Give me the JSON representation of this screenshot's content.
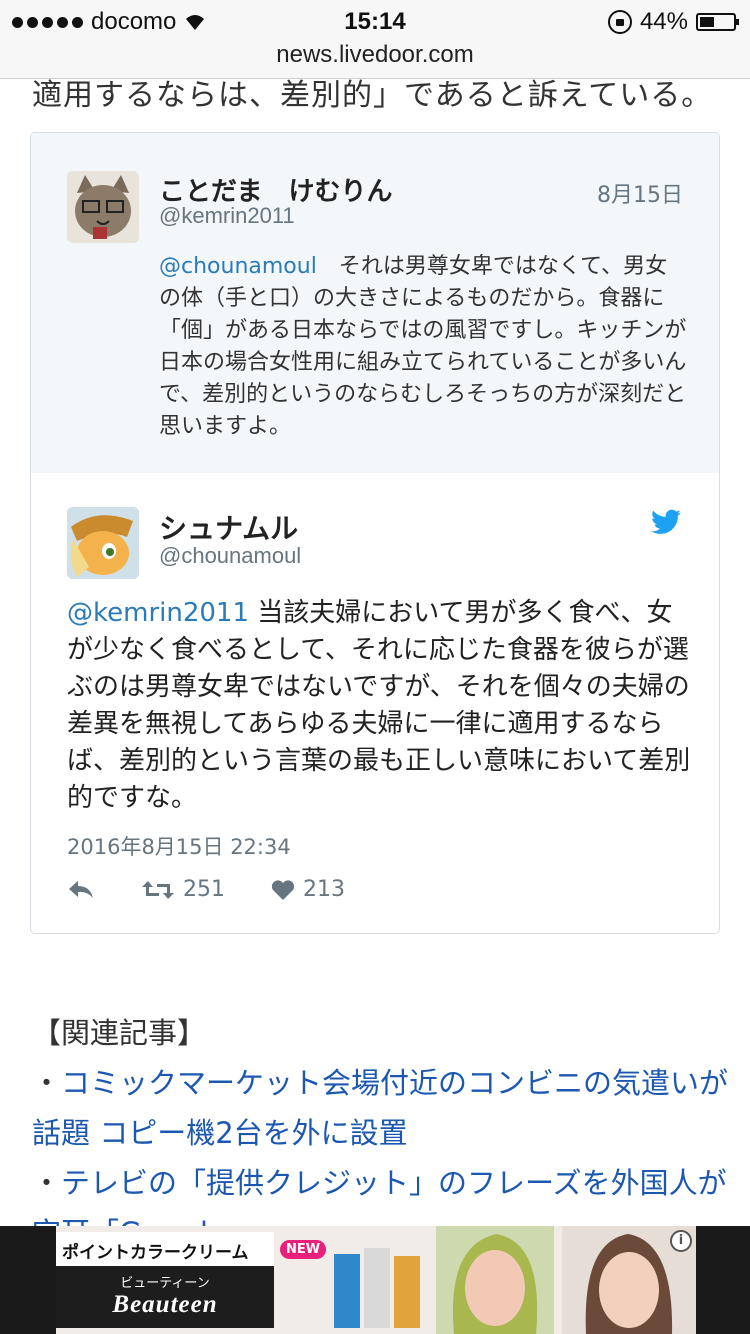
{
  "status_bar": {
    "carrier": "docomo",
    "time": "15:14",
    "battery_text": "44%",
    "battery_level": 0.44
  },
  "browser": {
    "url": "news.livedoor.com"
  },
  "article": {
    "cut_line": "適用するならは、差別的」であると訴えている。"
  },
  "tweet": {
    "quoted": {
      "name": "ことだま　けむりん",
      "handle": "@kemrin2011",
      "date": "8月15日",
      "mention": "@chounamoul",
      "text": "　それは男尊女卑ではなくて、男女の体（手と口）の大きさによるものだから。食器に「個」がある日本ならではの風習ですし。キッチンが日本の場合女性用に組み立てられていることが多いんで、差別的というのならむしろそっちの方が深刻だと思いますよ。"
    },
    "main": {
      "name": "シュナムル",
      "handle": "@chounamoul",
      "mention": "@kemrin2011",
      "text": " 当該夫婦において男が多く食べ、女が少なく食べるとして、それに応じた食器を彼らが選ぶのは男尊女卑ではないですが、それを個々の夫婦の差異を無視してあらゆる夫婦に一律に適用するならば、差別的という言葉の最も正しい意味において差別的ですな。",
      "datetime": "2016年8月15日 22:34",
      "retweets": "251",
      "likes": "213"
    },
    "colors": {
      "link": "#2b7bb9",
      "twitter_blue": "#1da1f2"
    }
  },
  "related": {
    "heading": "【関連記事】",
    "items": [
      {
        "bullet": "・",
        "text": "コミックマーケット会場付近のコンビニの気遣いが話題 コピー機2台を外に設置"
      },
      {
        "bullet": "・",
        "text": "テレビの「提供クレジット」のフレーズを外国人が空耳「Grand sponsor…」"
      }
    ]
  },
  "ad": {
    "tagline": "ポイントカラークリーム",
    "badge": "NEW",
    "brand_jp": "ビューティーン",
    "brand_en": "Beauteen",
    "info_icon": "i"
  }
}
